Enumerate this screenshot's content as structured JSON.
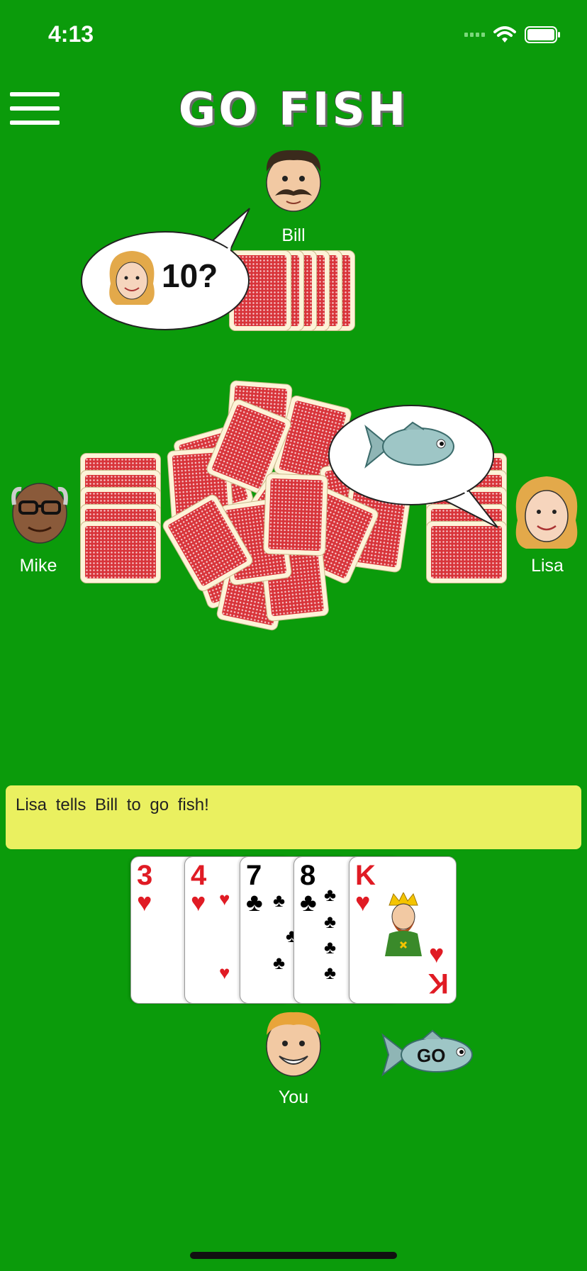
{
  "status_bar": {
    "time": "4:13"
  },
  "header": {
    "title": "GO FISH"
  },
  "players": {
    "top": {
      "name": "Bill"
    },
    "left": {
      "name": "Mike"
    },
    "right": {
      "name": "Lisa"
    },
    "bottom": {
      "name": "You"
    }
  },
  "speech": {
    "lisa_asks": "10?"
  },
  "message": "Lisa tells Bill to go fish!",
  "hand": [
    {
      "rank": "3",
      "suit": "♥",
      "color": "red"
    },
    {
      "rank": "4",
      "suit": "♥",
      "color": "red"
    },
    {
      "rank": "7",
      "suit": "♣",
      "color": "black"
    },
    {
      "rank": "8",
      "suit": "♣",
      "color": "black"
    },
    {
      "rank": "K",
      "suit": "♥",
      "color": "red"
    }
  ],
  "go_button": {
    "label": "GO"
  },
  "colors": {
    "table": "#0b9b0b",
    "message_bg": "#eaf060",
    "card_back": "#d8343a"
  }
}
